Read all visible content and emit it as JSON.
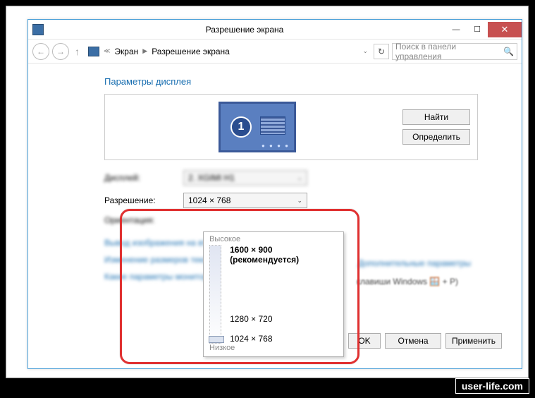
{
  "window_title": "Разрешение экрана",
  "breadcrumb": {
    "root": "Экран",
    "current": "Разрешение экрана"
  },
  "search_placeholder": "Поиск в панели управления",
  "heading": "Параметры дисплея",
  "buttons": {
    "find": "Найти",
    "detect": "Определить"
  },
  "monitor_number": "1",
  "labels": {
    "display": "Дисплей:",
    "resolution": "Разрешение:",
    "orientation": "Ориентация:"
  },
  "dropdowns": {
    "display_value": "2. XGIMI H1",
    "resolution_value": "1024 × 768"
  },
  "popup": {
    "high": "Высокое",
    "low": "Низкое",
    "recommended": "1600 × 900 (рекомендуется)",
    "opt_1280": "1280 × 720",
    "opt_1024": "1024 × 768"
  },
  "side_link": "Дополнительные параметры",
  "winp_text": "клавиши Windows 🪟 + P)",
  "bottom_links": {
    "l1": "Вывод изображения на второй экран",
    "l2": "Изменение размеров текста и других элементов",
    "l3": "Какие параметры монитора следует выбрать?"
  },
  "action_buttons": {
    "ok": "OK",
    "cancel": "Отмена",
    "apply": "Применить"
  },
  "watermark": "user-life.com"
}
